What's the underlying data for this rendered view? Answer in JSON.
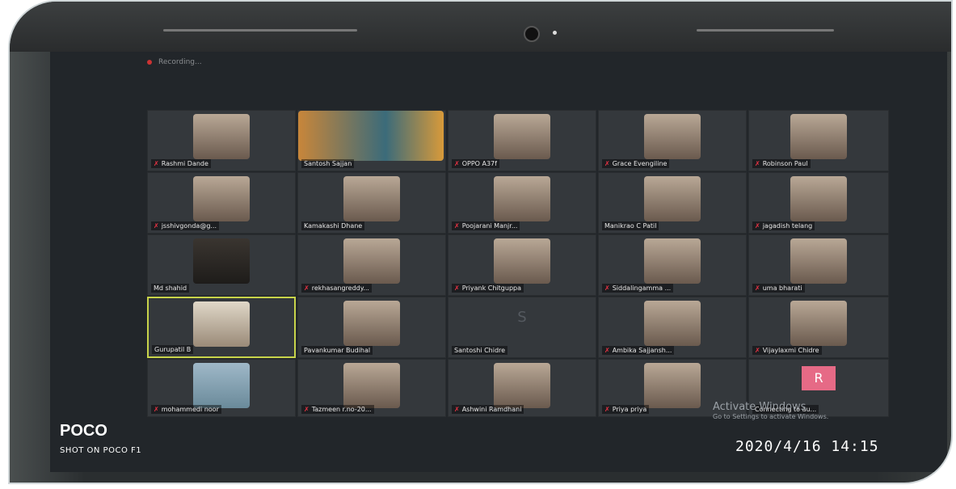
{
  "recording": {
    "label": "Recording..."
  },
  "participants": [
    {
      "name": "Rashmi Dande",
      "muted": true
    },
    {
      "name": "Santosh Sajjan",
      "muted": false
    },
    {
      "name": "OPPO A37f",
      "muted": true
    },
    {
      "name": "Grace Evengiline",
      "muted": true
    },
    {
      "name": "Robinson Paul",
      "muted": true
    },
    {
      "name": "jsshivgonda@g...",
      "muted": true
    },
    {
      "name": "Kamakashi Dhane",
      "muted": false
    },
    {
      "name": "Poojarani Manjr...",
      "muted": true
    },
    {
      "name": "Manikrao C Patil",
      "muted": false
    },
    {
      "name": "jagadish telang",
      "muted": true
    },
    {
      "name": "Md shahid",
      "muted": false
    },
    {
      "name": "rekhasangreddy...",
      "muted": true
    },
    {
      "name": "Priyank Chitguppa",
      "muted": true
    },
    {
      "name": "Siddalingamma ...",
      "muted": true
    },
    {
      "name": "uma bharati",
      "muted": true
    },
    {
      "name": "Gurupatil B",
      "muted": false
    },
    {
      "name": "Pavankumar Budihal",
      "muted": false
    },
    {
      "name": "Santoshi Chidre",
      "muted": false,
      "initial": "S"
    },
    {
      "name": "Ambika Sajjansh...",
      "muted": true
    },
    {
      "name": "Vijaylaxmi Chidre",
      "muted": true
    },
    {
      "name": "mohammedi noor",
      "muted": true
    },
    {
      "name": "Tazmeen r.no-20...",
      "muted": true
    },
    {
      "name": "Ashwini Ramdhani",
      "muted": true
    },
    {
      "name": "Priya priya",
      "muted": true
    },
    {
      "name": "Connecting to au...",
      "muted": false,
      "initial": "R"
    }
  ],
  "watermark": {
    "title": "Activate Windows",
    "subtitle": "Go to Settings to activate Windows."
  },
  "camera": {
    "brand": "POCO",
    "model": "SHOT ON POCO F1",
    "timestamp": "2020/4/16  14:15"
  },
  "colors": {
    "active_speaker": "#c8d44a",
    "avatar_r": "#e66a86"
  }
}
